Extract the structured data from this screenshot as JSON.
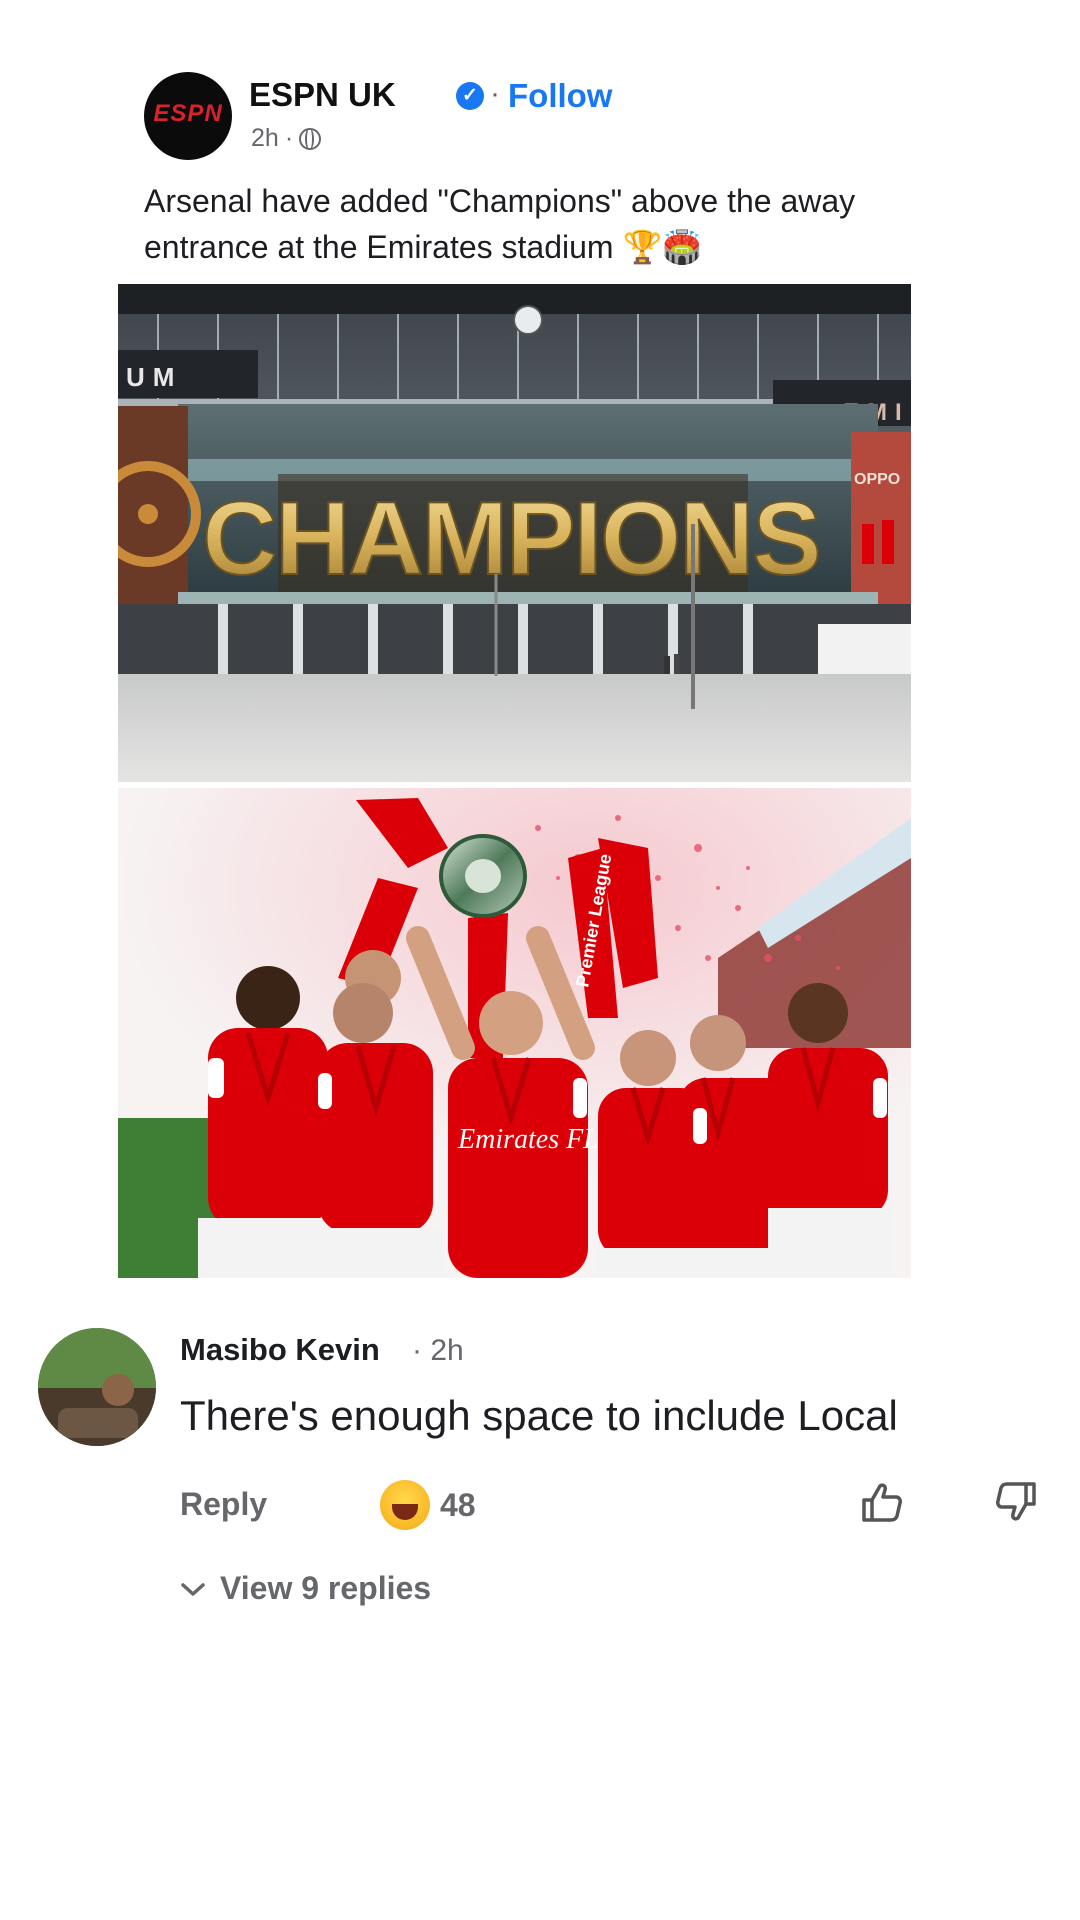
{
  "post": {
    "page_name": "ESPN UK",
    "logo_text": "ESPN",
    "follow_label": "Follow",
    "separator": "·",
    "time": "2h",
    "time_separator": "·",
    "caption": "Arsenal have added \"Champions\" above the away entrance at the Emirates stadium 🏆🏟️",
    "images": [
      {
        "sign_text": "CHAMPIONS",
        "corner_left": "UM",
        "corner_right": "EMI",
        "side_banner": "OPPO"
      },
      {
        "banner_text": "Premier League",
        "shirt_text": "Emirates FLY BETTER"
      }
    ]
  },
  "comment": {
    "author": "Masibo Kevin",
    "time": "· 2h",
    "text": "There's enough space to include Local",
    "reply_label": "Reply",
    "reaction_count": "48",
    "view_replies_label": "View 9 replies"
  },
  "icons": {
    "verified": "verified-badge-icon",
    "privacy": "globe-icon",
    "like": "thumbs-up-icon",
    "dislike": "thumbs-down-icon",
    "expand": "chevron-down-icon",
    "reaction": "laughing-emoji-icon"
  },
  "colors": {
    "link_blue": "#1877f2",
    "espn_red": "#d8232a",
    "arsenal_red": "#db0007",
    "champions_gold": "#d8b25a",
    "muted_text": "#65676b"
  }
}
